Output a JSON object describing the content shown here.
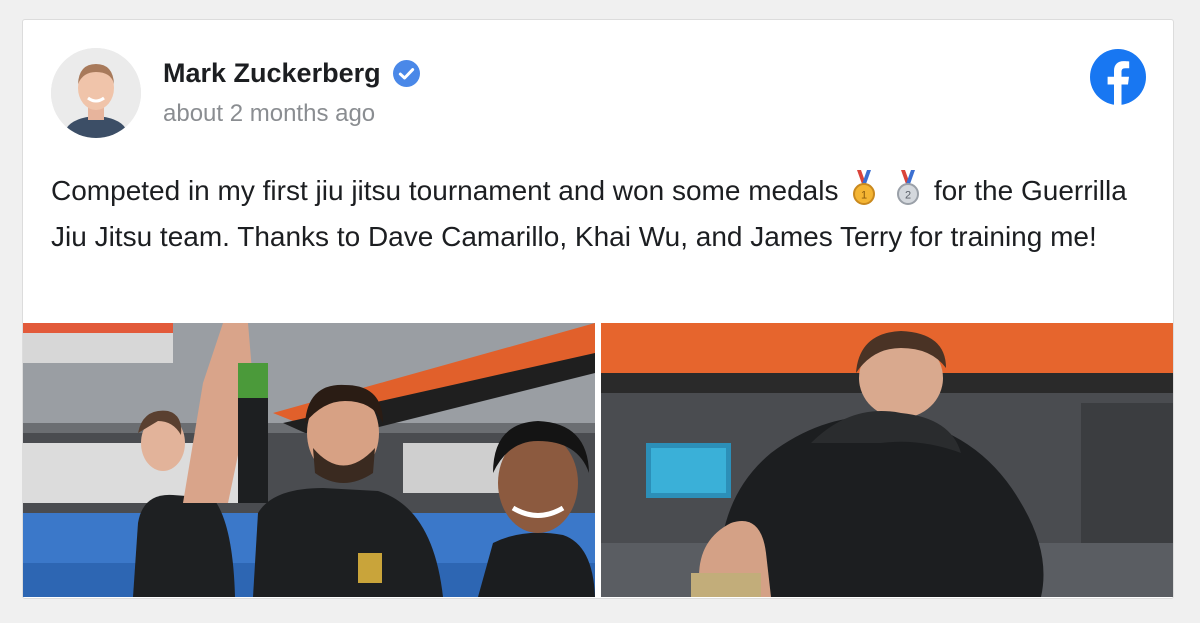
{
  "post": {
    "author": "Mark Zuckerberg",
    "timestamp": "about 2 months ago",
    "text_part1": "Competed in my first jiu jitsu tournament and won some medals",
    "text_part2": "for the Guerrilla Jiu Jitsu team. Thanks to Dave Camarillo, Khai Wu, and James Terry for training me!",
    "medal_icons": [
      "gold-medal-icon",
      "silver-medal-icon"
    ]
  },
  "icons": {
    "verified": "verified-badge-icon",
    "platform": "facebook-icon"
  },
  "colors": {
    "facebook_blue": "#1877f2",
    "verified_blue": "#4a88e8",
    "name_text": "#1c1e21",
    "timestamp_text": "#8a8d91"
  },
  "media": [
    {
      "type": "photo",
      "depicts": "referee raising winner's arm at mat"
    },
    {
      "type": "photo",
      "depicts": "two competitors grappling"
    }
  ]
}
